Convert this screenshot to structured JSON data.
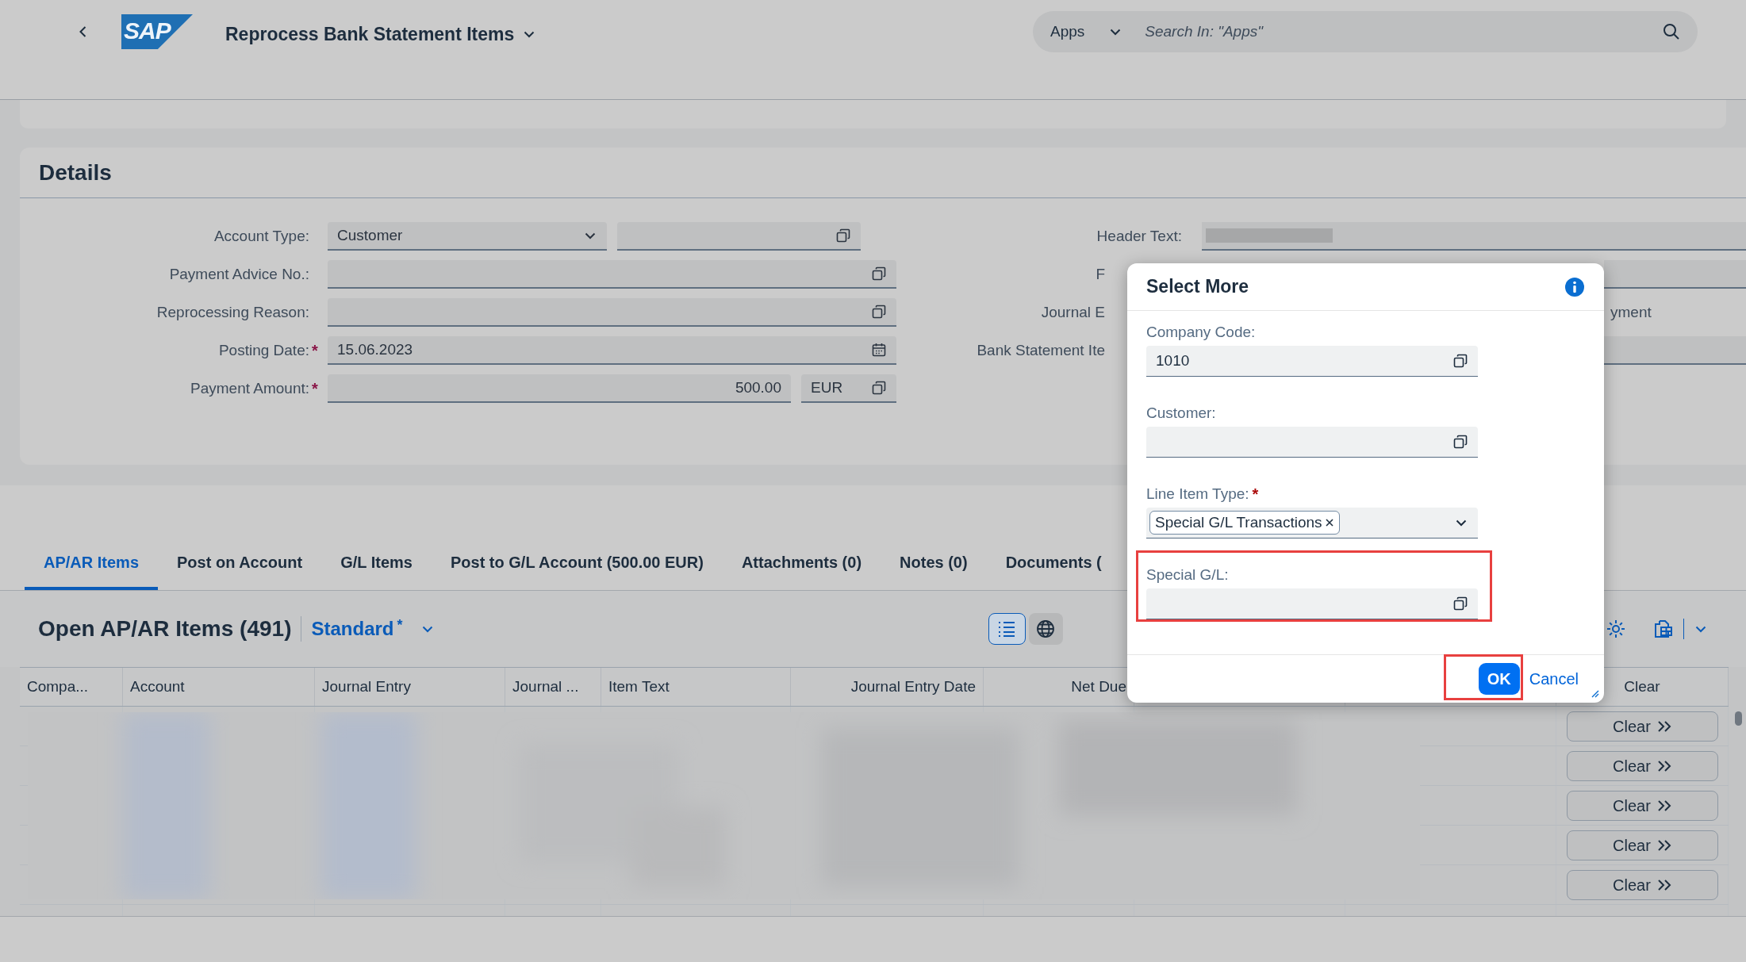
{
  "shell": {
    "logo": "SAP",
    "title": "Reprocess Bank Statement Items",
    "search_scope": "Apps",
    "search_placeholder": "Search In: \"Apps\""
  },
  "details": {
    "title": "Details",
    "left_fields": [
      {
        "kind": "select",
        "label": "Account Type:",
        "required": false,
        "value": "Customer"
      },
      {
        "kind": "valuehelp",
        "label": "Payment Advice No.:",
        "required": false
      },
      {
        "kind": "valuehelp",
        "label": "Reprocessing Reason:",
        "required": false
      },
      {
        "kind": "date",
        "label": "Posting Date:",
        "required": true,
        "required_mark": "*",
        "value": "15.06.2023"
      },
      {
        "kind": "amount",
        "label": "Payment Amount:",
        "required": true,
        "required_mark": "*",
        "value": "500.00",
        "currency": "EUR"
      }
    ],
    "right_fields": [
      {
        "kind": "blurred",
        "label": "Header Text:"
      },
      {
        "kind": "field_tail",
        "label": "F"
      },
      {
        "kind": "text_tail",
        "label": "Journal E",
        "tail": "yment"
      },
      {
        "kind": "field_tail",
        "label": "Bank Statement Ite"
      }
    ]
  },
  "tabs": [
    {
      "label": "AP/AR Items",
      "selected": true
    },
    {
      "label": "Post on Account",
      "selected": false
    },
    {
      "label": "G/L Items",
      "selected": false
    },
    {
      "label": "Post to G/L Account (500.00 EUR)",
      "selected": false
    },
    {
      "label": "Attachments (0)",
      "selected": false
    },
    {
      "label": "Notes (0)",
      "selected": false
    },
    {
      "label": "Documents (",
      "selected": false
    }
  ],
  "table": {
    "title": "Open AP/AR Items (491)",
    "variant": "Standard",
    "variant_modified": true,
    "modified_mark": "*",
    "columns": [
      "Compa...",
      "Account",
      "Journal Entry",
      "Journal ...",
      "Item Text",
      "Journal Entry Date",
      "Net Due",
      "Clear"
    ],
    "rows": [
      {
        "action": "Clear"
      },
      {
        "action": "Clear"
      },
      {
        "action": "Clear"
      },
      {
        "action": "Clear"
      },
      {
        "action": "Clear"
      }
    ]
  },
  "dialog": {
    "title": "Select More",
    "fields": [
      {
        "kind": "valuehelp",
        "label": "Company Code:",
        "required": false,
        "value": "1010",
        "highlighted": false
      },
      {
        "kind": "valuehelp",
        "label": "Customer:",
        "required": false,
        "highlighted": false
      },
      {
        "kind": "multiselect",
        "label": "Line Item Type:",
        "required": true,
        "required_mark": "*",
        "token": "Special G/L Transactions",
        "highlighted": false
      },
      {
        "kind": "valuehelp",
        "label": "Special G/L:",
        "required": false,
        "highlighted": true
      }
    ],
    "ok": "OK",
    "cancel": "Cancel",
    "ok_highlighted": true
  }
}
